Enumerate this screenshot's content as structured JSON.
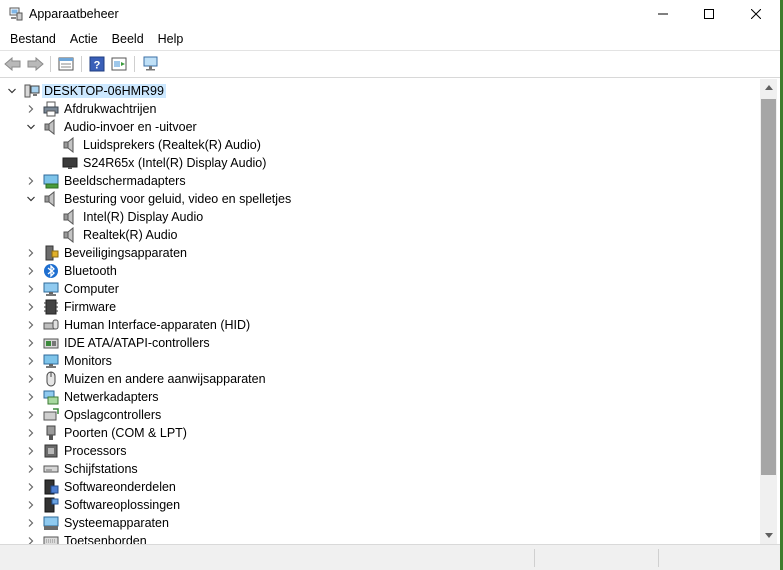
{
  "window": {
    "title": "Apparaatbeheer",
    "accent": "#3a7b2a"
  },
  "menu": [
    "Bestand",
    "Actie",
    "Beeld",
    "Help"
  ],
  "toolbar": {
    "buttons": [
      "back-icon",
      "forward-icon",
      "properties-view-icon",
      "help-icon",
      "update-driver-icon",
      "scan-monitor-icon"
    ]
  },
  "tree": {
    "root": "DESKTOP-06HMR99",
    "nodes": [
      {
        "label": "Afdrukwachtrijen",
        "icon": "printer-icon",
        "level": 1,
        "state": "collapsed"
      },
      {
        "label": "Audio-invoer en -uitvoer",
        "icon": "speaker-icon",
        "level": 1,
        "state": "expanded"
      },
      {
        "label": "Luidsprekers (Realtek(R) Audio)",
        "icon": "speaker-icon",
        "level": 2,
        "state": "leaf"
      },
      {
        "label": "S24R65x (Intel(R) Display Audio)",
        "icon": "monitor-dark-icon",
        "level": 2,
        "state": "leaf"
      },
      {
        "label": "Beeldschermadapters",
        "icon": "display-adapter-icon",
        "level": 1,
        "state": "collapsed"
      },
      {
        "label": "Besturing voor geluid, video en spelletjes",
        "icon": "speaker-icon",
        "level": 1,
        "state": "expanded"
      },
      {
        "label": "Intel(R) Display Audio",
        "icon": "speaker-icon",
        "level": 2,
        "state": "leaf"
      },
      {
        "label": "Realtek(R) Audio",
        "icon": "speaker-icon",
        "level": 2,
        "state": "leaf"
      },
      {
        "label": "Beveiligingsapparaten",
        "icon": "security-device-icon",
        "level": 1,
        "state": "collapsed"
      },
      {
        "label": "Bluetooth",
        "icon": "bluetooth-icon",
        "level": 1,
        "state": "collapsed"
      },
      {
        "label": "Computer",
        "icon": "computer-icon",
        "level": 1,
        "state": "collapsed"
      },
      {
        "label": "Firmware",
        "icon": "firmware-icon",
        "level": 1,
        "state": "collapsed"
      },
      {
        "label": "Human Interface-apparaten (HID)",
        "icon": "hid-icon",
        "level": 1,
        "state": "collapsed"
      },
      {
        "label": "IDE ATA/ATAPI-controllers",
        "icon": "ide-controller-icon",
        "level": 1,
        "state": "collapsed"
      },
      {
        "label": "Monitors",
        "icon": "monitor-icon",
        "level": 1,
        "state": "collapsed"
      },
      {
        "label": "Muizen en andere aanwijsapparaten",
        "icon": "mouse-icon",
        "level": 1,
        "state": "collapsed"
      },
      {
        "label": "Netwerkadapters",
        "icon": "network-adapter-icon",
        "level": 1,
        "state": "collapsed"
      },
      {
        "label": "Opslagcontrollers",
        "icon": "storage-controller-icon",
        "level": 1,
        "state": "collapsed"
      },
      {
        "label": "Poorten (COM & LPT)",
        "icon": "port-icon",
        "level": 1,
        "state": "collapsed"
      },
      {
        "label": "Processors",
        "icon": "processor-icon",
        "level": 1,
        "state": "collapsed"
      },
      {
        "label": "Schijfstations",
        "icon": "disk-drive-icon",
        "level": 1,
        "state": "collapsed"
      },
      {
        "label": "Softwareonderdelen",
        "icon": "software-component-icon",
        "level": 1,
        "state": "collapsed"
      },
      {
        "label": "Softwareoplossingen",
        "icon": "software-device-icon",
        "level": 1,
        "state": "collapsed"
      },
      {
        "label": "Systeemapparaten",
        "icon": "system-device-icon",
        "level": 1,
        "state": "collapsed"
      },
      {
        "label": "Toetsenborden",
        "icon": "keyboard-icon",
        "level": 1,
        "state": "collapsed"
      }
    ]
  }
}
